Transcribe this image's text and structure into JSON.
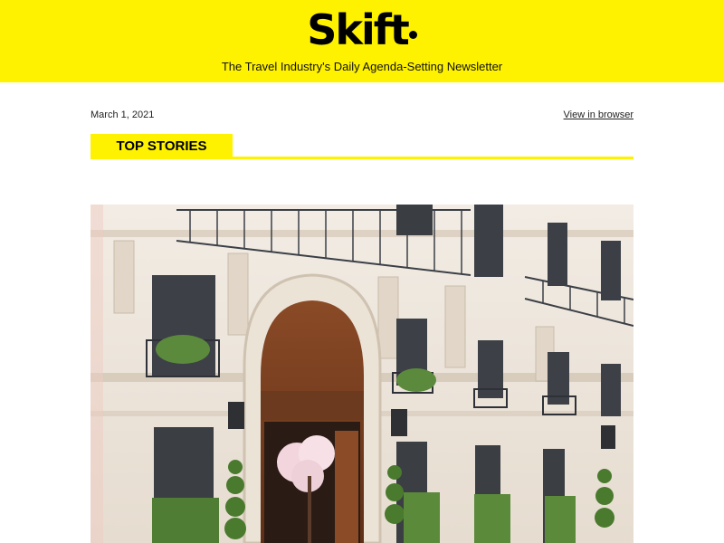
{
  "header": {
    "logo_text": "Skift",
    "tagline": "The Travel Industry's Daily Agenda-Setting Newsletter",
    "background_color": "#fff200"
  },
  "meta": {
    "date": "March 1, 2021",
    "view_in_browser": "View in browser"
  },
  "section": {
    "title": "TOP STORIES",
    "accent_color": "#fff200"
  },
  "hero_image": {
    "subject": "Parisian hotel facade with arched wooden doorway, wrought-iron balconies and potted topiary"
  }
}
